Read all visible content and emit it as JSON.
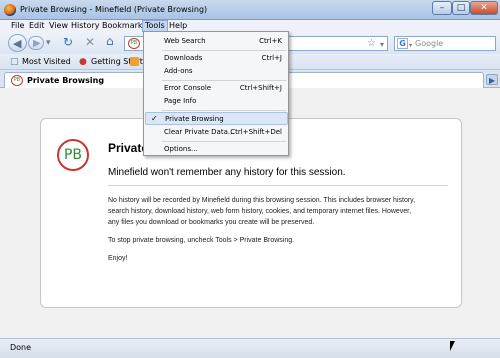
{
  "window": {
    "title": "Private Browsing - Minefield (Private Browsing)",
    "controls": [
      "–",
      "□",
      "✕"
    ]
  },
  "menubar": {
    "items": [
      "File",
      "Edit",
      "View",
      "History",
      "Bookmarks",
      "Tools",
      "Help"
    ],
    "active": "Tools"
  },
  "navbar": {
    "url_icon_text": "PB",
    "star": "☆",
    "search_placeholder": "Google"
  },
  "bookmarks": {
    "items": [
      "Most Visited",
      "Getting Started"
    ]
  },
  "tab": {
    "label": "Private Browsing",
    "favicon_text": "PB"
  },
  "content": {
    "logo_text": "PB",
    "title": "Private",
    "subtitle": "Minefield won't remember any history for this session.",
    "paragraph1": "No history will be recorded by Minefield during this browsing session. This includes browser history, search history, download history, web form history, cookies, and temporary internet files. However, any files you download or bookmarks you create will be preserved.",
    "paragraph2": "To stop private browsing, uncheck Tools > Private Browsing.",
    "paragraph3": "Enjoy!"
  },
  "status": {
    "text": "Done"
  },
  "tools_menu": {
    "items": [
      {
        "label": "Web Search",
        "shortcut": "Ctrl+K"
      },
      {
        "label": "Downloads",
        "shortcut": "Ctrl+J"
      },
      {
        "label": "Add-ons",
        "shortcut": ""
      },
      {
        "label": "Error Console",
        "shortcut": "Ctrl+Shift+J"
      },
      {
        "label": "Page Info",
        "shortcut": ""
      },
      {
        "label": "Private Browsing",
        "shortcut": "",
        "checked": true
      },
      {
        "label": "Clear Private Data...",
        "shortcut": "Ctrl+Shift+Del"
      },
      {
        "label": "Options...",
        "shortcut": ""
      }
    ],
    "check_glyph": "✓"
  },
  "colors": {
    "accent": "#c4d6ee",
    "logo_ring": "#c9382e",
    "logo_text": "#2e8b3a"
  }
}
